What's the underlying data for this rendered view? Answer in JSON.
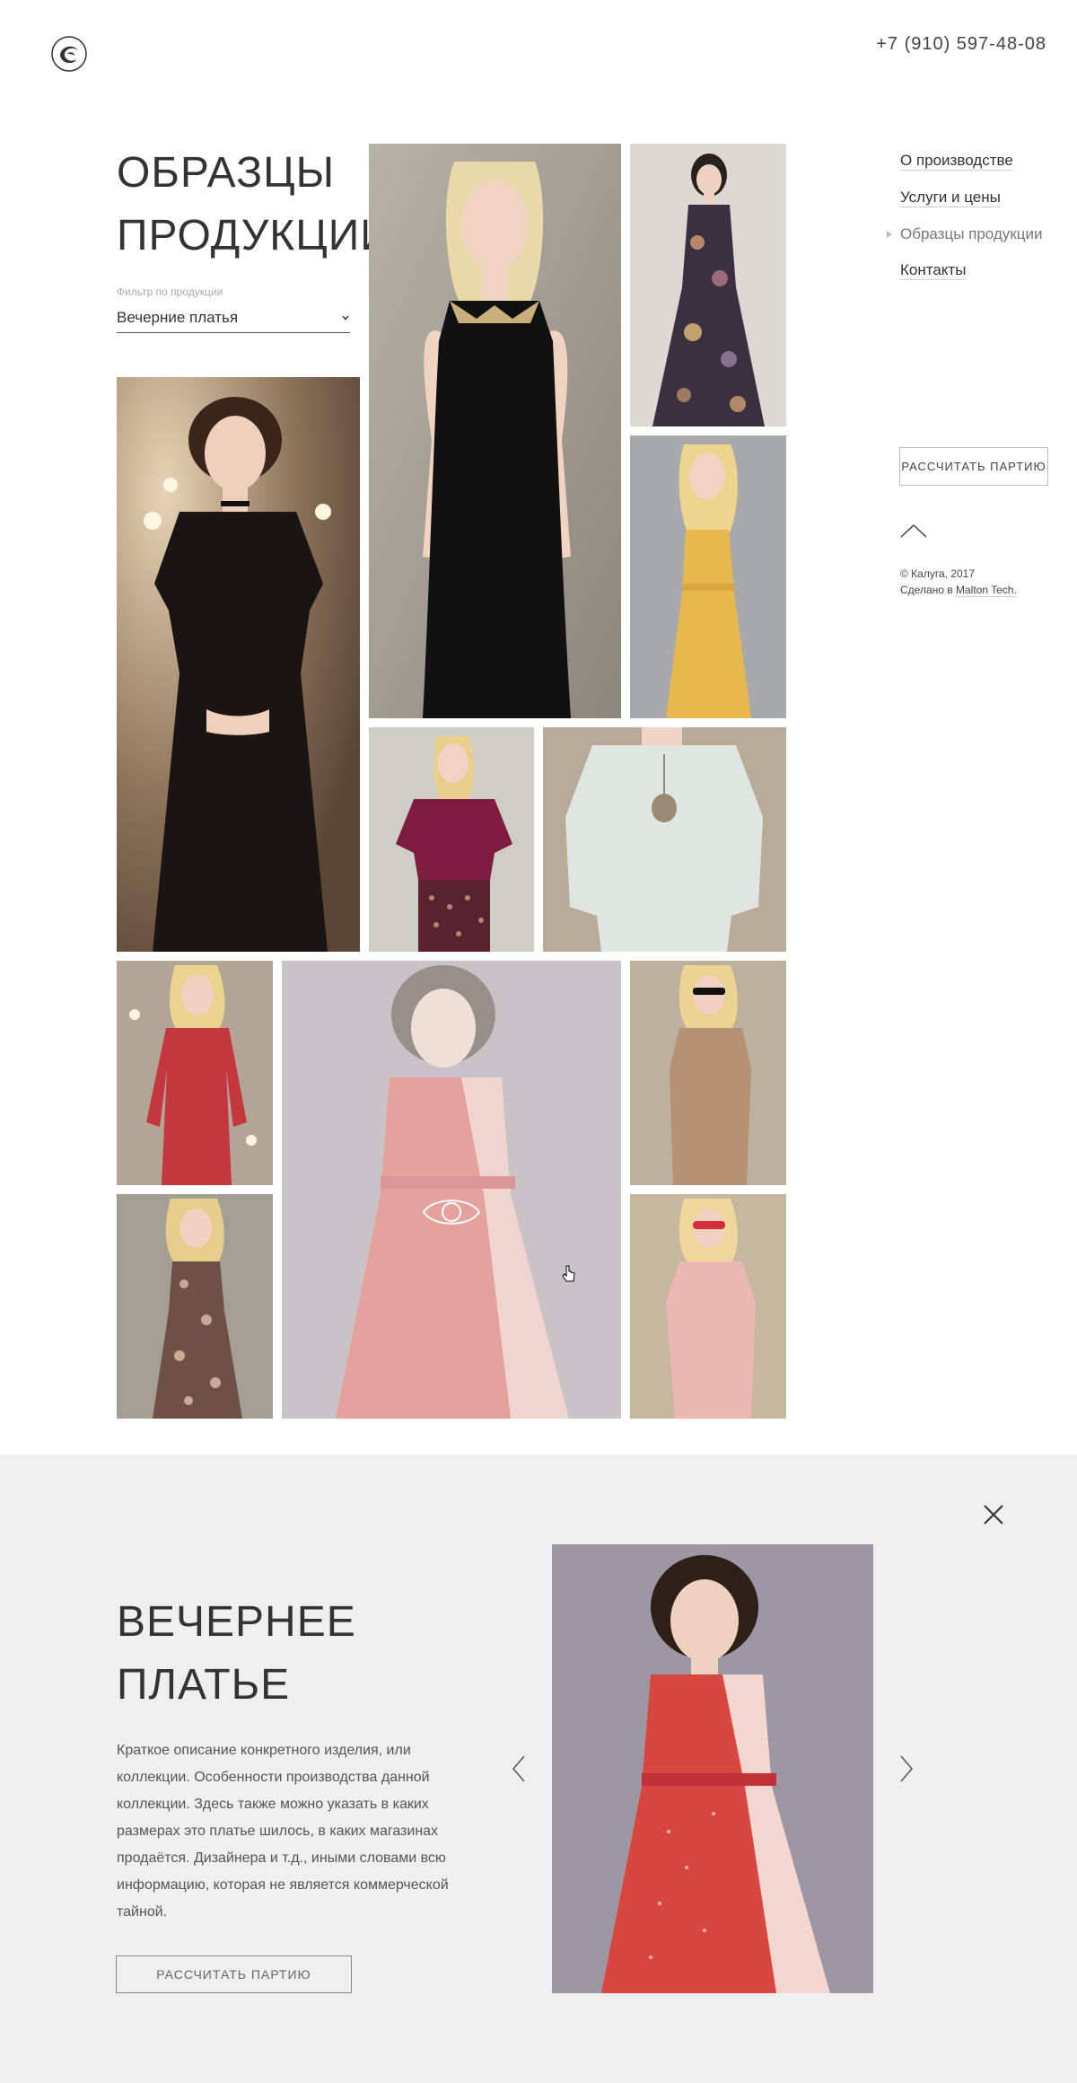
{
  "header": {
    "phone": "+7 (910) 597-48-08"
  },
  "page": {
    "title": "ОБРАЗЦЫ ПРОДУКЦИИ"
  },
  "filter": {
    "label": "Фильтр по продукции",
    "value": "Вечерние платья"
  },
  "nav": {
    "items": [
      {
        "label": "О производстве"
      },
      {
        "label": "Услуги и цены"
      },
      {
        "label": "Образцы продукции"
      },
      {
        "label": "Контакты"
      }
    ]
  },
  "sidebar": {
    "calc_button": "РАССЧИТАТЬ ПАРТИЮ",
    "copyright": "© Калуга, 2017",
    "made_by_prefix": "Сделано в",
    "made_by_link": "Malton Tech."
  },
  "gallery": {
    "items": [
      {
        "name": "black-bodycon-dress",
        "dress": "#111111"
      },
      {
        "name": "floral-dress",
        "dress": "#3a3040"
      },
      {
        "name": "yellow-dress",
        "dress": "#e7b84e"
      },
      {
        "name": "black-short-dress",
        "dress": "#1a1514"
      },
      {
        "name": "burgundy-top",
        "dress": "#7d1c3e"
      },
      {
        "name": "white-lace-blouse",
        "dress": "#dfe6e2"
      },
      {
        "name": "red-long-sleeve-dress",
        "dress": "#c4373e"
      },
      {
        "name": "red-lace-dress-hovered",
        "dress": "#d8473f"
      },
      {
        "name": "beige-dress",
        "dress": "#b59175"
      },
      {
        "name": "brown-floral-dress",
        "dress": "#6e5046"
      },
      {
        "name": "pink-dress",
        "dress": "#eab7b3"
      }
    ]
  },
  "detail": {
    "title": "ВЕЧЕРНЕЕ ПЛАТЬЕ",
    "description": "Краткое описание конкретного изделия, или коллекции. Особенности производства данной коллекции. Здесь также можно указать в каких размерах это платье шилось, в каких магазинах продаётся. Дизайнера и т.д., иными словами всю информацию, которая не является коммерческой тайной.",
    "button": "РАССЧИТАТЬ ПАРТИЮ"
  }
}
